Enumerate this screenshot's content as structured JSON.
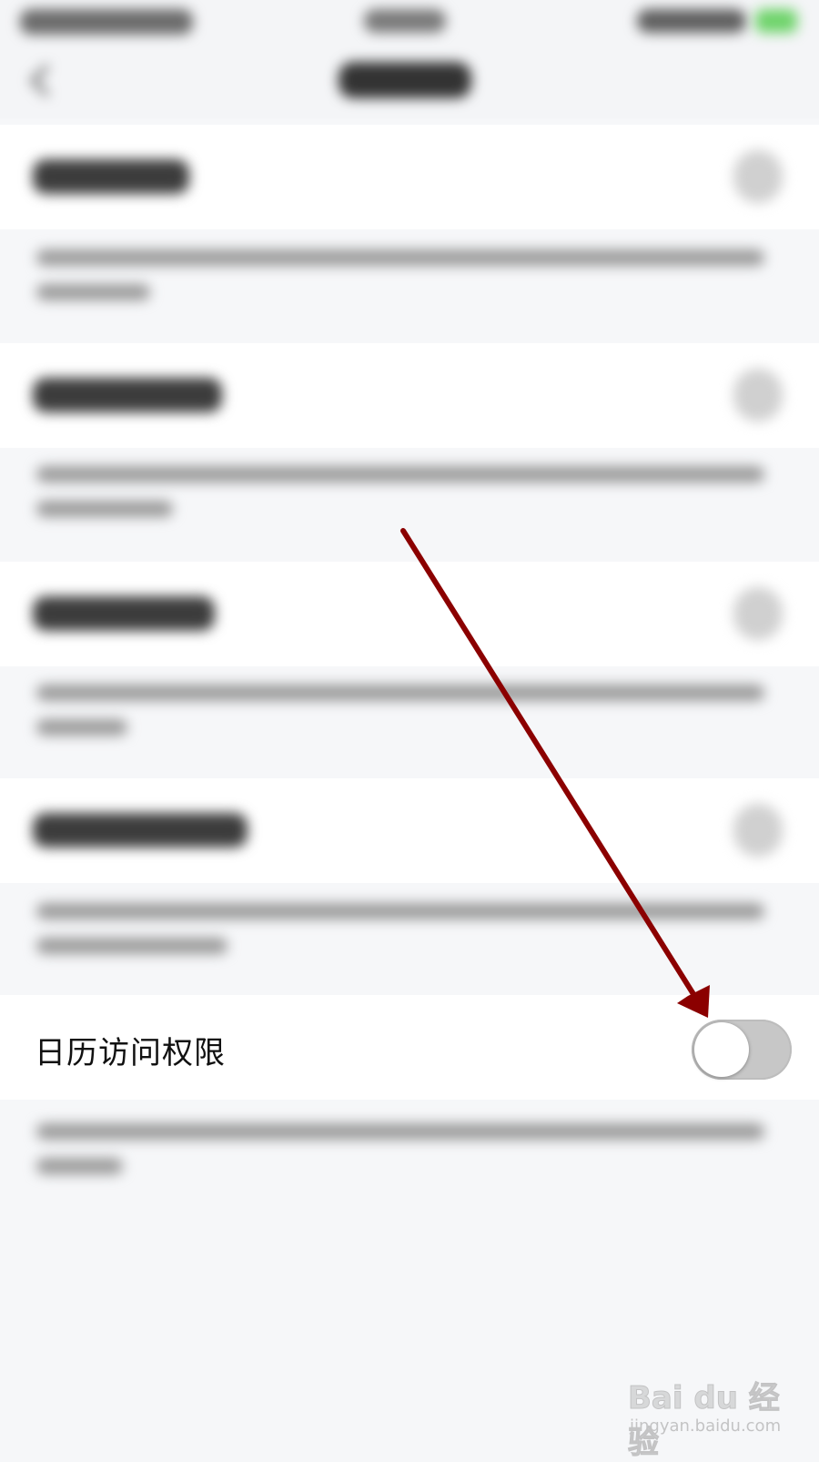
{
  "calendar_permission": {
    "label": "日历访问权限",
    "toggle_on": false
  },
  "colors": {
    "annotation_arrow": "#8b0000",
    "toggle_off_track": "#c7c7c7"
  },
  "watermark": {
    "logo_text": "Bai du 经验",
    "url": "jingyan.baidu.com"
  }
}
